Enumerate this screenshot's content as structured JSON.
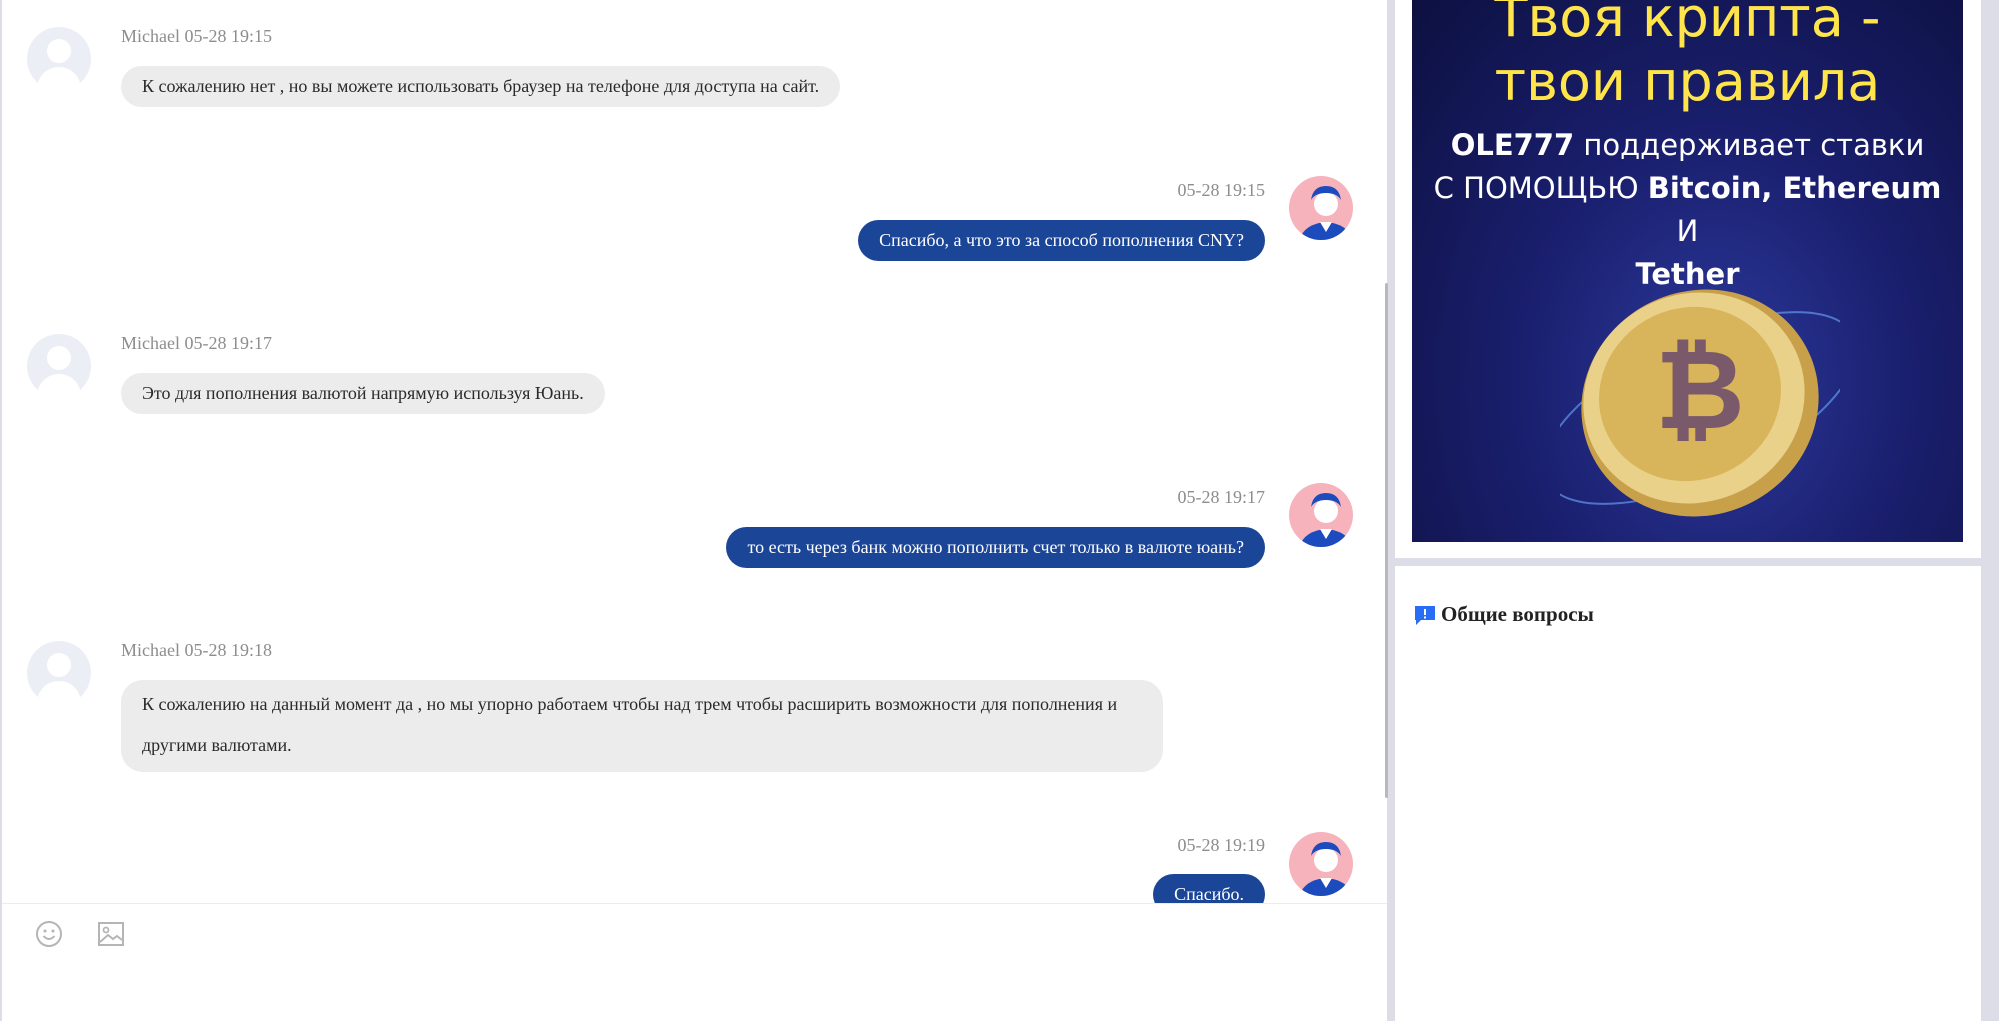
{
  "chat": {
    "messages": [
      {
        "sender": "agent",
        "name": "Michael",
        "time": "05-28 19:15",
        "text": "К сожалению нет , но вы можете использовать браузер на телефоне для доступа на сайт."
      },
      {
        "sender": "user",
        "time": "05-28 19:15",
        "text": "Спасибо, а что это за способ пополнения CNY?"
      },
      {
        "sender": "agent",
        "name": "Michael",
        "time": "05-28 19:17",
        "text": "Это для пополнения валютой напрямую используя Юань."
      },
      {
        "sender": "user",
        "time": "05-28 19:17",
        "text": "то есть через банк можно пополнить счет только в валюте юань?"
      },
      {
        "sender": "agent",
        "name": "Michael",
        "time": "05-28 19:18",
        "text": "К сожалению на данный момент да , но мы упорно работаем чтобы над трем чтобы расширить возможности для пополнения и другими валютами."
      },
      {
        "sender": "user",
        "time": "05-28 19:19",
        "text": "Спасибо."
      }
    ]
  },
  "input": {
    "emoji_icon": "smiley-icon",
    "image_icon": "image-icon"
  },
  "banner": {
    "line1": "Твоя крипта -",
    "line2": "твои правила",
    "brand": "OLE777",
    "line3_rest": " поддерживает ставки",
    "line4_prefix": "С ПОМОЩЬЮ ",
    "line4_coins": "Bitcoin, Ethereum",
    "line4_suffix": " И",
    "line5": "Tether"
  },
  "faq": {
    "title": "Общие вопросы",
    "icon": "message-alert-icon"
  },
  "colors": {
    "user_bubble": "#1b4597",
    "agent_bubble": "#ececec",
    "banner_text": "#ffe54a",
    "faq_icon": "#2a6df5"
  }
}
